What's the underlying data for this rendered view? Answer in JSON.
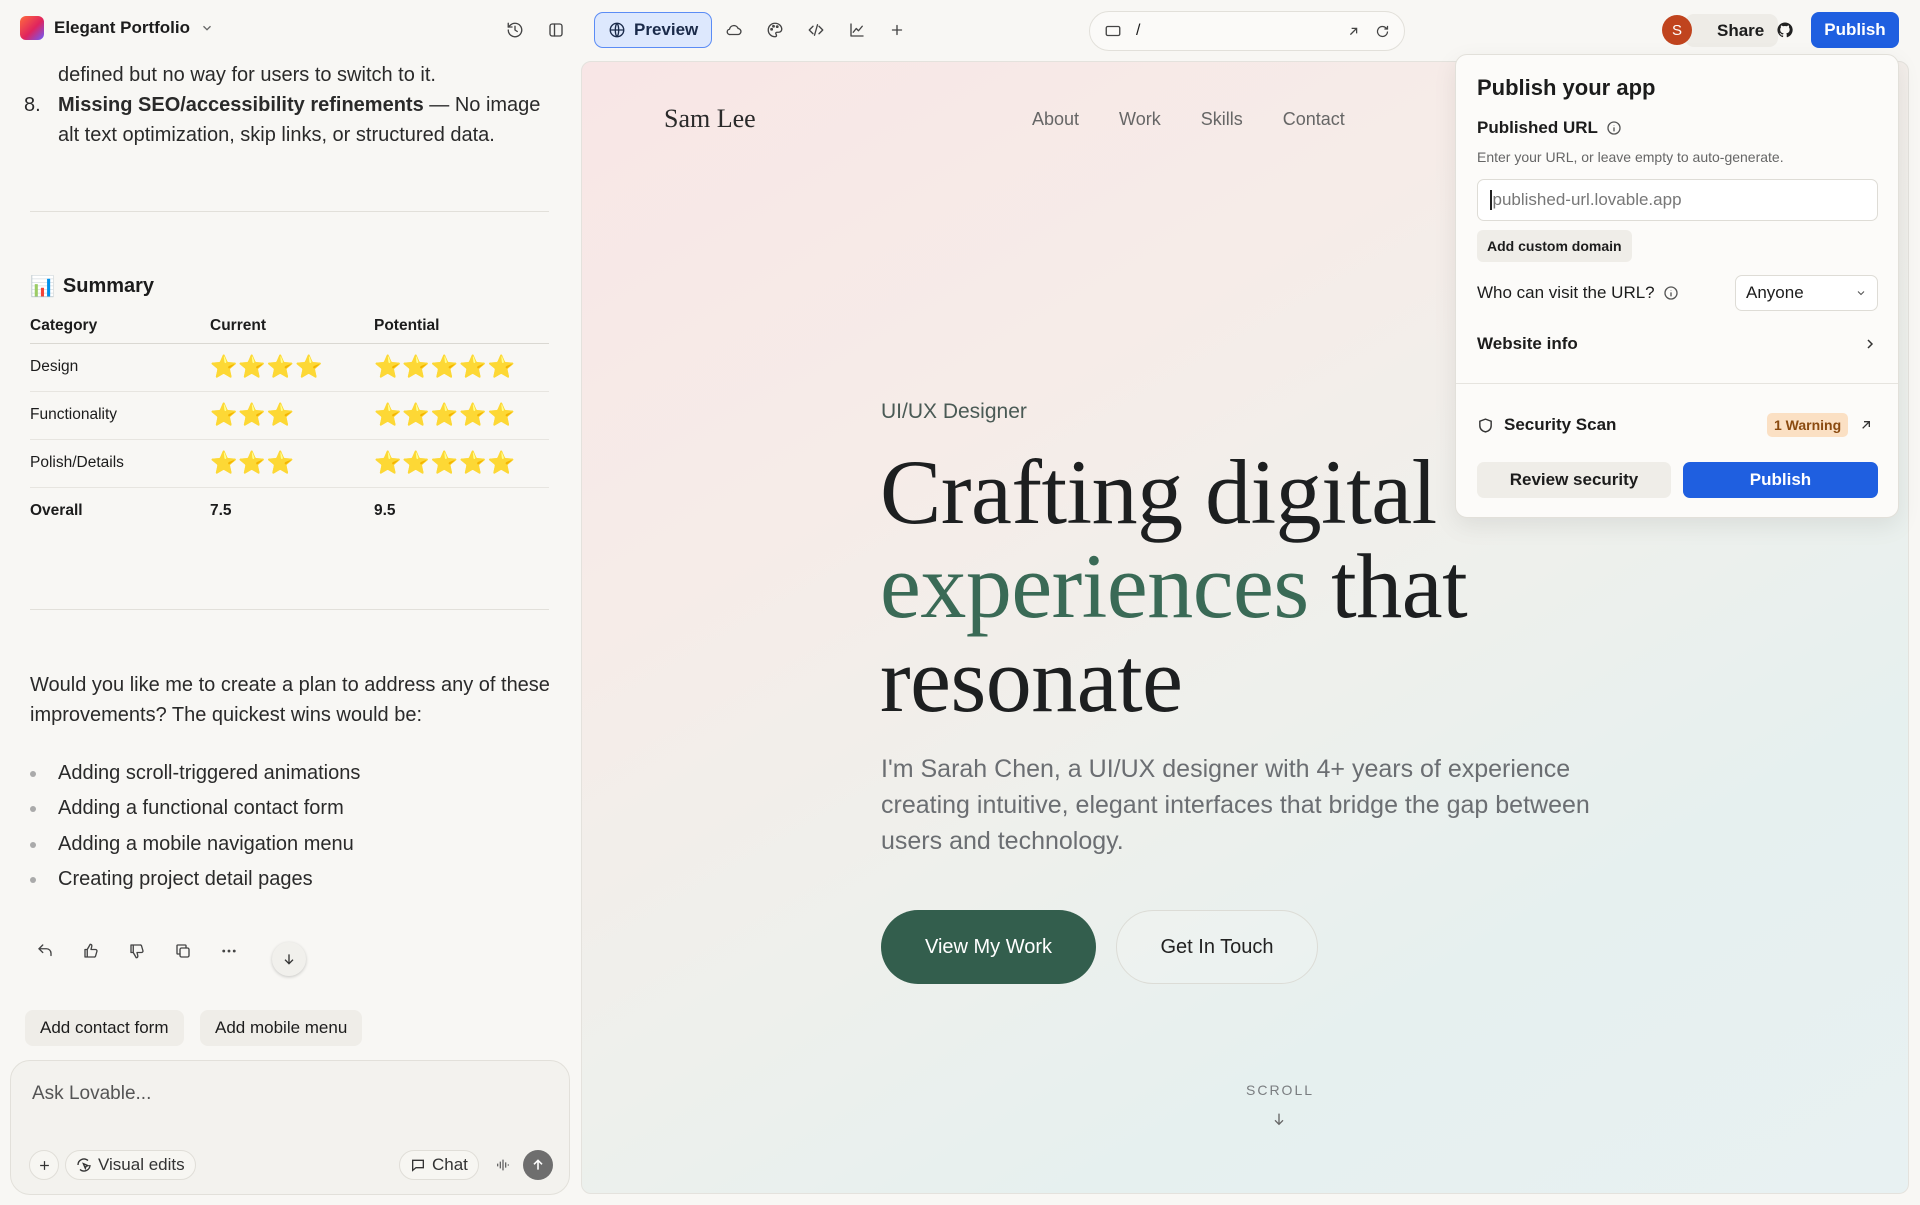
{
  "topbar": {
    "project_name": "Elegant Portfolio",
    "preview_label": "Preview",
    "url_path": "/",
    "avatar_initial": "S",
    "share_label": "Share",
    "publish_label": "Publish"
  },
  "chat": {
    "list_tail_line1": "defined but no way for users to switch to it.",
    "item8_num": "8.",
    "item8_bold": "Missing SEO/accessibility refinements",
    "item8_rest_line1": " — No image",
    "item8_line2": "alt text optimization, skip links, or structured data.",
    "summary_emoji": "📊",
    "summary_title": "Summary",
    "table": {
      "headers": [
        "Category",
        "Current",
        "Potential"
      ],
      "rows": [
        {
          "category": "Design",
          "current": "⭐⭐⭐⭐",
          "potential": "⭐⭐⭐⭐⭐"
        },
        {
          "category": "Functionality",
          "current": "⭐⭐⭐",
          "potential": "⭐⭐⭐⭐⭐"
        },
        {
          "category": "Polish/Details",
          "current": "⭐⭐⭐",
          "potential": "⭐⭐⭐⭐⭐"
        },
        {
          "category": "Overall",
          "current": "7.5",
          "potential": "9.5"
        }
      ]
    },
    "question_line1": "Would you like me to create a plan to address any of these",
    "question_line2": "improvements? The quickest wins would be:",
    "quick_wins": [
      "Adding scroll-triggered animations",
      "Adding a functional contact form",
      "Adding a mobile navigation menu",
      "Creating project detail pages"
    ],
    "suggestions": [
      "Add contact form",
      "Add mobile menu"
    ],
    "input_placeholder": "Ask Lovable...",
    "visual_edits_label": "Visual edits",
    "chat_label": "Chat"
  },
  "site": {
    "name": "Sam Lee",
    "nav": [
      "About",
      "Work",
      "Skills",
      "Contact"
    ],
    "role": "UI/UX Designer",
    "headline_line1": "Crafting digital",
    "headline_accent": "experiences",
    "headline_line2_rest": " that",
    "headline_line3": "resonate",
    "intro": "I'm Sarah Chen, a UI/UX designer with 4+ years of experience creating intuitive, elegant interfaces that bridge the gap between users and technology.",
    "btn_primary": "View My Work",
    "btn_secondary": "Get In Touch",
    "scroll_label": "SCROLL"
  },
  "publish_popup": {
    "title": "Publish your app",
    "url_label": "Published URL",
    "url_hint": "Enter your URL, or leave empty to auto-generate.",
    "url_placeholder": "published-url.lovable.app",
    "custom_domain": "Add custom domain",
    "visibility_label": "Who can visit the URL?",
    "visibility_value": "Anyone",
    "website_info": "Website info",
    "security_scan": "Security Scan",
    "warning_badge": "1 Warning",
    "review_label": "Review security",
    "publish_label": "Publish"
  },
  "colors": {
    "accent_green": "#335e4d",
    "publish_blue": "#1f5fe0",
    "warning_bg": "#fbe0c4"
  }
}
